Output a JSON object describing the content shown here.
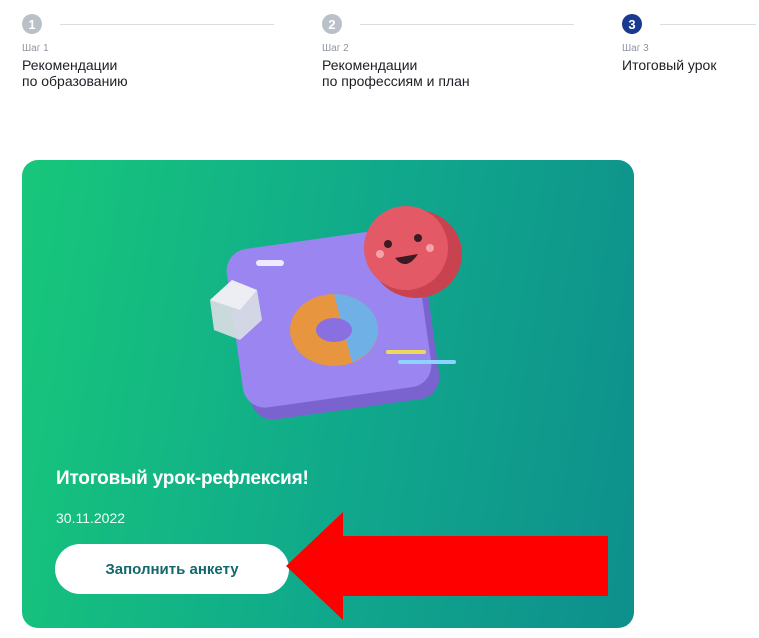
{
  "steps": [
    {
      "number": "1",
      "subtitle": "Шаг 1",
      "title": "Рекомендации\nпо образованию",
      "state": "done"
    },
    {
      "number": "2",
      "subtitle": "Шаг 2",
      "title": "Рекомендации\nпо профессиям и план",
      "state": "done"
    },
    {
      "number": "3",
      "subtitle": "Шаг 3",
      "title": "Итоговый урок",
      "state": "current"
    }
  ],
  "card": {
    "title": "Итоговый урок-рефлексия!",
    "date": "30.11.2022",
    "button_label": "Заполнить анкету",
    "illustration": "smiley-donut-illustration"
  },
  "annotation": {
    "icon": "red-arrow-icon",
    "color": "#ff0000"
  },
  "colors": {
    "step_done": "#b9c0c7",
    "step_current": "#1a3a8f",
    "card_gradient_start": "#17c77a",
    "card_gradient_end": "#0e8f8c",
    "button_text": "#12686b"
  }
}
